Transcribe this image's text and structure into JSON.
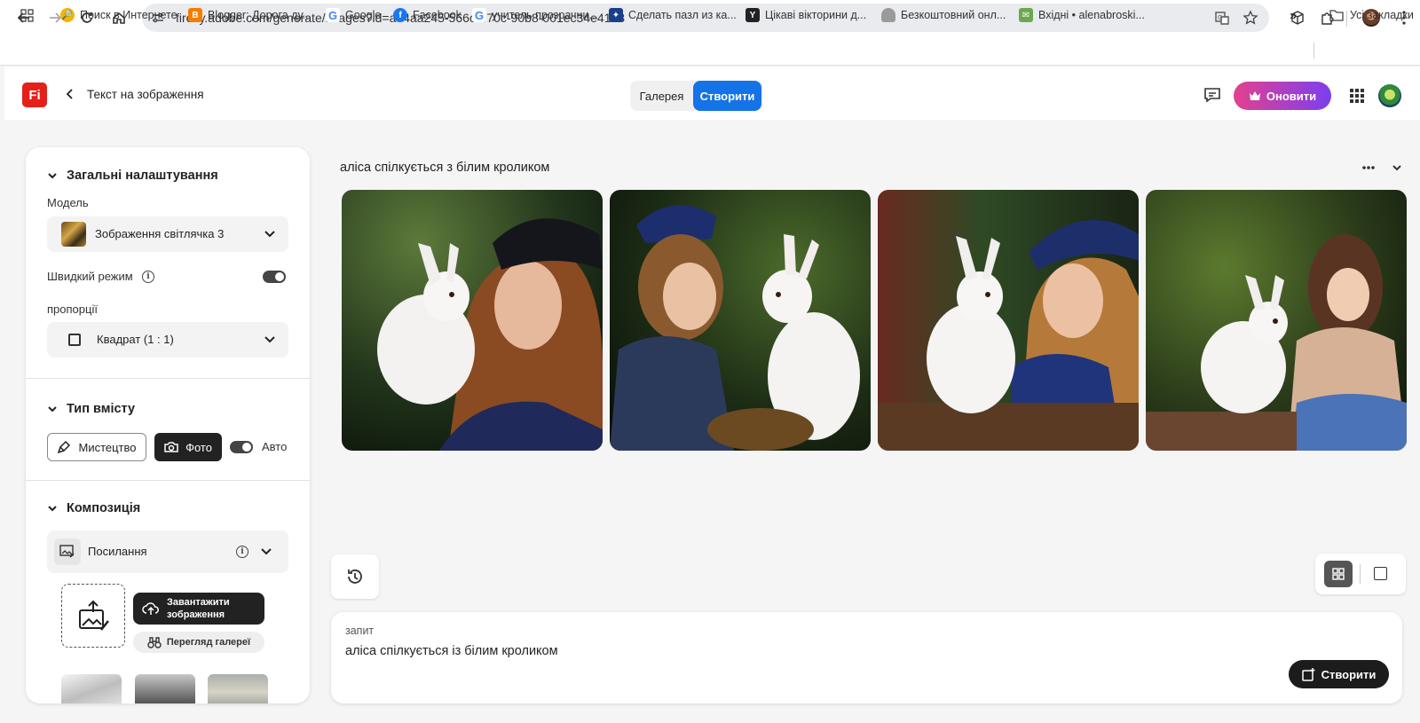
{
  "browser": {
    "url": "firefly.adobe.com/generate/images?id=a34aa245-566c-470c-90b8-001ec34e41a8",
    "bookmarks": [
      {
        "label": "Поиск в Интернете",
        "icon": "search-bookmark-icon",
        "color": "#f4b400"
      },
      {
        "label": "Blogger: Дорога ду...",
        "icon": "blogger-icon",
        "color": "#f57d00"
      },
      {
        "label": "Google",
        "icon": "google-icon",
        "color": "#4285f4"
      },
      {
        "label": "Facebook",
        "icon": "facebook-icon",
        "color": "#1877f2"
      },
      {
        "label": "учитель прозрачни...",
        "icon": "google-icon",
        "color": "#4285f4"
      },
      {
        "label": "Сделать пазл из ка...",
        "icon": "puzzle-icon",
        "color": "#1a3f8a"
      },
      {
        "label": "Цікаві вікторини д...",
        "icon": "quiz-icon",
        "color": "#222222"
      },
      {
        "label": "Безкоштовний онл...",
        "icon": "cloud-icon",
        "color": "#8a8a8a"
      },
      {
        "label": "Вхідні • alenabroski...",
        "icon": "mail-icon",
        "color": "#6aa84f"
      }
    ],
    "all_bookmarks": "Усі закладки"
  },
  "header": {
    "logo": "Fi",
    "title": "Текст на зображення",
    "tabs": {
      "gallery": "Галерея",
      "create": "Створити"
    },
    "upgrade": "Оновити"
  },
  "settings": {
    "general_title": "Загальні налаштування",
    "model_label": "Модель",
    "model_value": "Зображення світлячка 3",
    "fast_mode_label": "Швидкий режим",
    "fast_mode_on": true,
    "aspect_label": "пропорції",
    "aspect_value": "Квадрат (1 : 1)",
    "content_type_title": "Тип вмісту",
    "art_label": "Мистецтво",
    "photo_label": "Фото",
    "auto_label": "Авто",
    "composition_title": "Композиція",
    "reference_label": "Посилання",
    "upload_label_1": "Завантажити",
    "upload_label_2": "зображення",
    "browse_gallery": "Перегляд галереї"
  },
  "main": {
    "result_title": "аліса спілкується з білим кроликом",
    "prompt_label": "запит",
    "prompt_value": "аліса спілкується із білим кроликом",
    "generate_button": "Створити"
  }
}
